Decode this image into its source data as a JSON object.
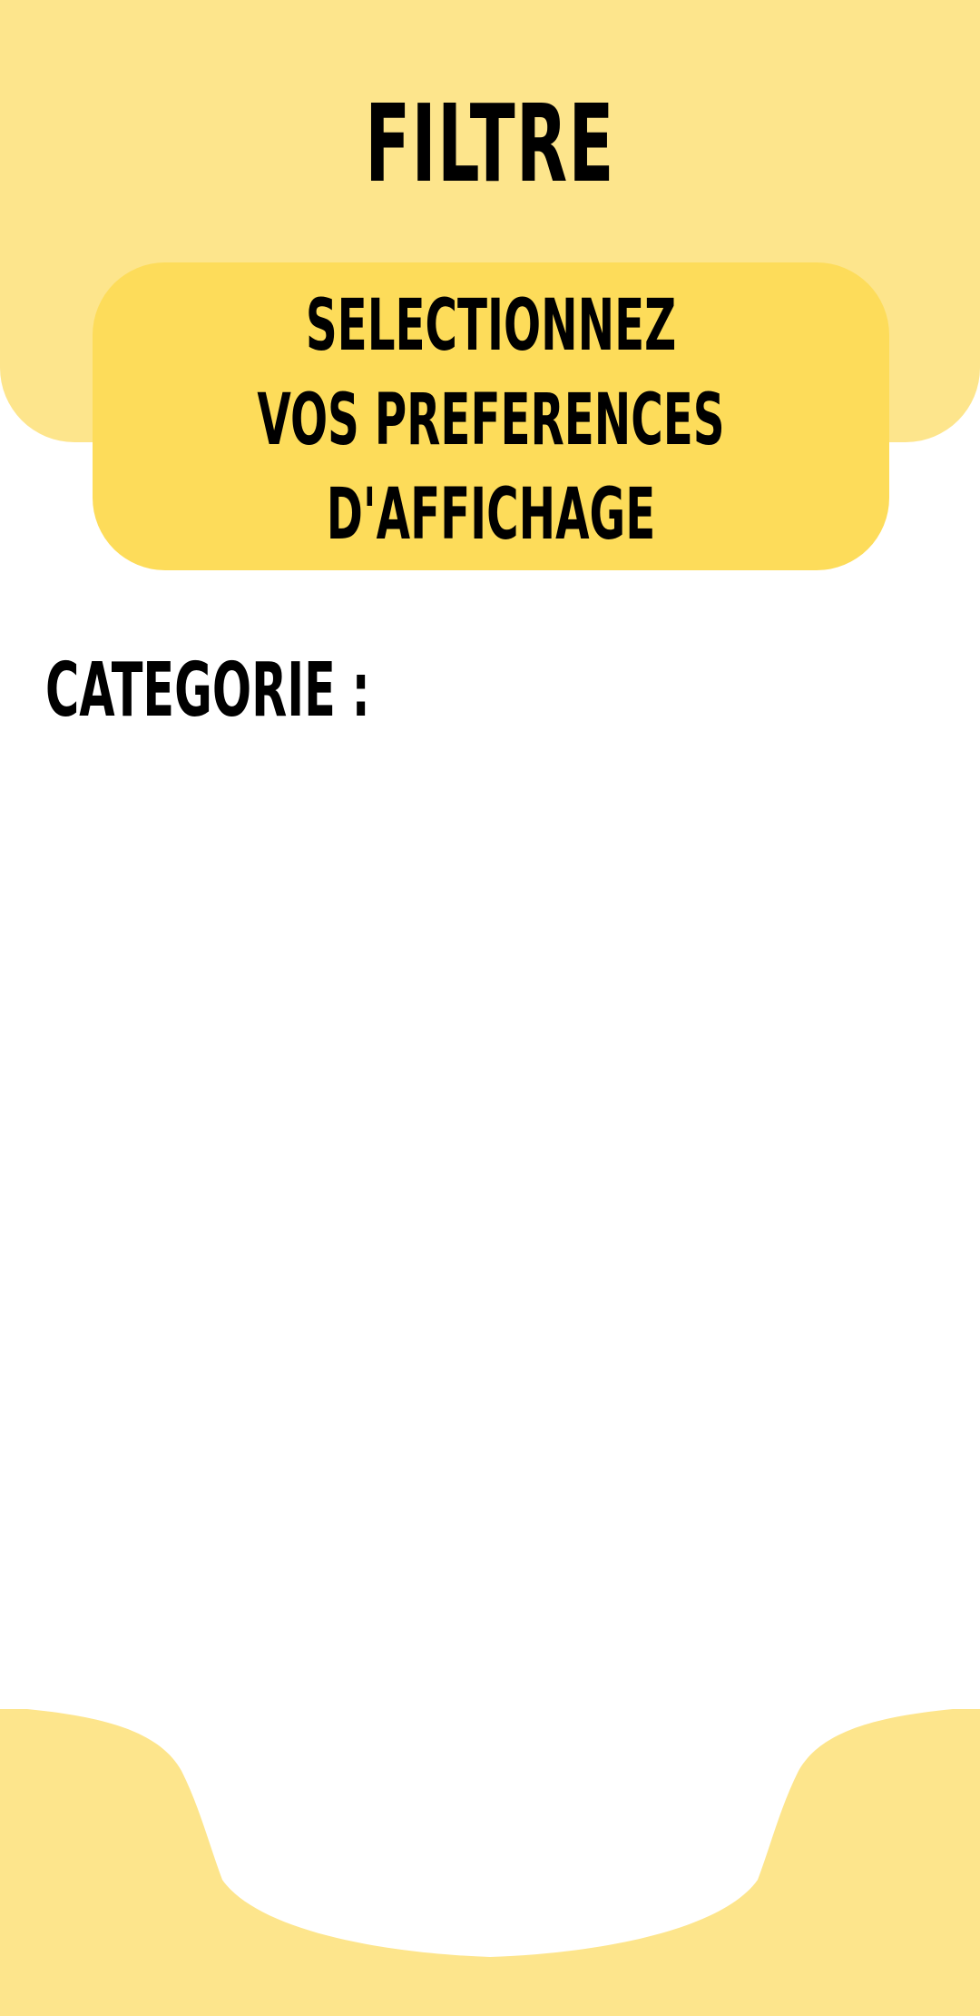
{
  "header": {
    "title": "FILTRE"
  },
  "instruction": {
    "line1": "SELECTIONNEZ",
    "line2": "VOS PREFERENCES",
    "line3": "D'AFFICHAGE"
  },
  "filters": {
    "category_label": "CATEGORIE :"
  },
  "colors": {
    "header_background": "#fde58c",
    "card_background": "#fddc5a",
    "page_background": "#ffffff",
    "text": "#000000"
  }
}
